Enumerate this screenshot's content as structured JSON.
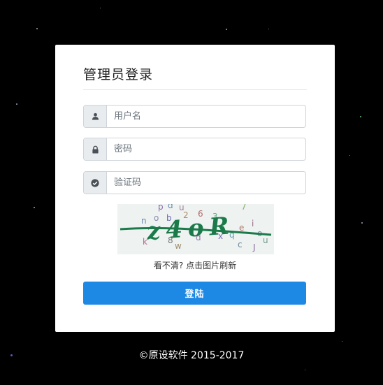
{
  "login": {
    "title": "管理员登录",
    "username_placeholder": "用户名",
    "password_placeholder": "密码",
    "captcha_placeholder": "验证码",
    "captcha_text": "z4oR",
    "captcha_noise": [
      "p",
      "d",
      "u",
      "6",
      "7",
      "b",
      "2",
      "3",
      "k",
      "n",
      "o",
      "8",
      "d",
      "q",
      "e",
      "x",
      "c",
      "J",
      "w",
      "u",
      "i",
      "o"
    ],
    "refresh_text": "看不清? 点击图片刷新",
    "submit_label": "登陆"
  },
  "footer": {
    "copyright": "©原设软件 2015-2017"
  },
  "colors": {
    "background": "#000000",
    "primary": "#1e88e5",
    "captcha_ink": "#1a7a4a"
  },
  "icons": {
    "username": "user-icon",
    "password": "lock-icon",
    "captcha": "check-circle-icon"
  }
}
